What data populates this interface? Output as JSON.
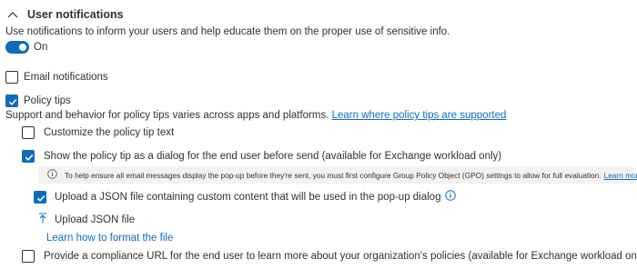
{
  "section": {
    "title": "User notifications",
    "description": "Use notifications to inform your users and help educate them on the proper use of sensitive info."
  },
  "toggle": {
    "label": "On",
    "state": "on"
  },
  "options": {
    "email": {
      "label": "Email notifications",
      "checked": false
    },
    "policy_tips": {
      "label": "Policy tips",
      "checked": true,
      "support_text": "Support and behavior for policy tips varies across apps and platforms.",
      "support_link": "Learn where policy tips are supported"
    },
    "customize": {
      "label": "Customize the policy tip text",
      "checked": false
    },
    "dialog": {
      "label": "Show the policy tip as a dialog for the end user before send (available for Exchange workload only)",
      "checked": true
    },
    "info_bar": {
      "text": "To help ensure all email messages display the pop-up before they're sent, you must first configure Group Policy Object (GPO) settings to allow for full evaluation.",
      "link": "Learn more"
    },
    "upload_json": {
      "label": "Upload a JSON file containing custom content that will be used in the pop-up dialog",
      "checked": true
    },
    "upload_button": "Upload JSON file",
    "format_link": "Learn how to format the file",
    "compliance_url": {
      "label": "Provide a compliance URL for the end user to learn more about your organization's policies (available for Exchange workload only)",
      "checked": false
    }
  },
  "colors": {
    "accent": "#0f6cbd",
    "text": "#323130",
    "infobar_bg": "#f3f2f1"
  }
}
